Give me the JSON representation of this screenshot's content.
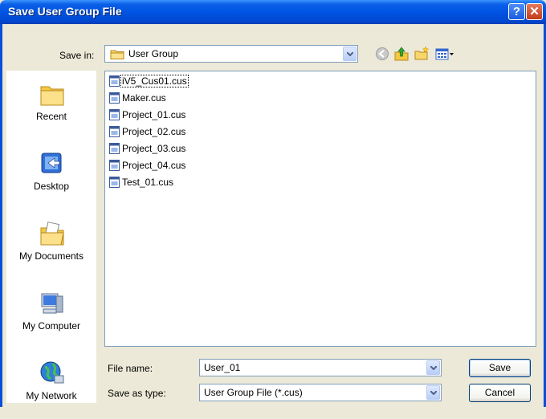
{
  "window": {
    "title": "Save User Group File",
    "help_glyph": "?",
    "close_glyph": "✕"
  },
  "save_in": {
    "label": "Save in:",
    "value": "User Group"
  },
  "toolbar": {
    "icons": [
      "back-icon",
      "up-folder-icon",
      "new-folder-icon",
      "view-menu-icon"
    ]
  },
  "places": [
    {
      "label": "Recent",
      "icon": "recent-folder-icon"
    },
    {
      "label": "Desktop",
      "icon": "desktop-icon"
    },
    {
      "label": "My Documents",
      "icon": "my-documents-icon"
    },
    {
      "label": "My Computer",
      "icon": "my-computer-icon"
    },
    {
      "label": "My Network",
      "icon": "my-network-icon"
    }
  ],
  "files": [
    "iV5_Cus01.cus",
    "Maker.cus",
    "Project_01.cus",
    "Project_02.cus",
    "Project_03.cus",
    "Project_04.cus",
    "Test_01.cus"
  ],
  "file_name": {
    "label": "File name:",
    "value": "User_01"
  },
  "save_as_type": {
    "label": "Save as type:",
    "value": "User Group File (*.cus)"
  },
  "buttons": {
    "save": "Save",
    "cancel": "Cancel"
  },
  "colors": {
    "titlebar": "#0054e3",
    "dialog_bg": "#ece9d8",
    "close_button": "#c2391a"
  }
}
